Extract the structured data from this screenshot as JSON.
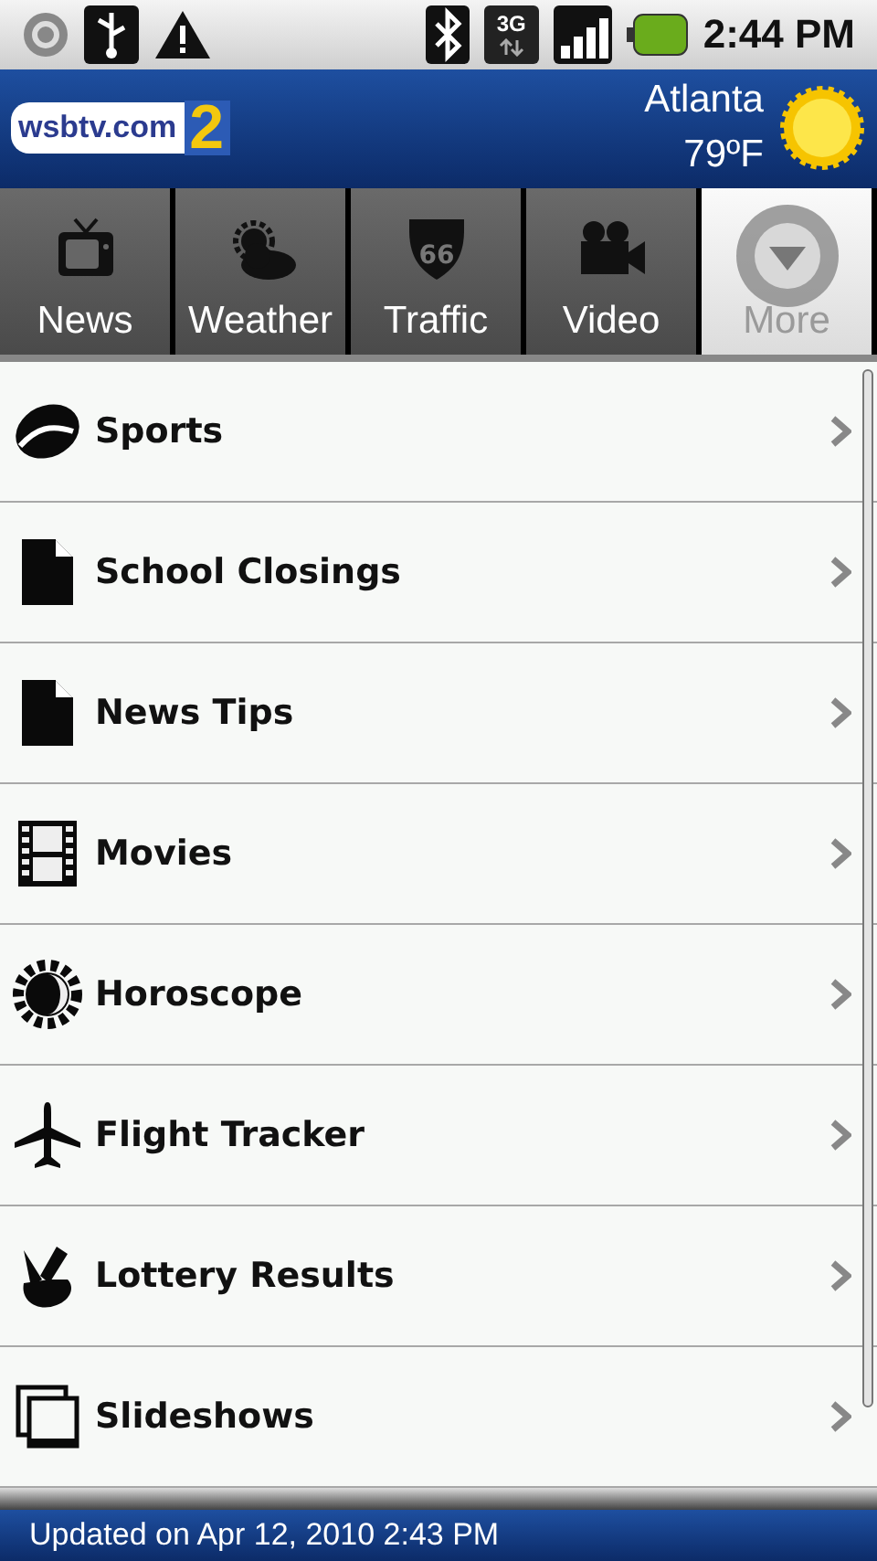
{
  "status_bar": {
    "network": "3G",
    "time": "2:44 PM"
  },
  "header": {
    "logo_text": "wsbtv.com",
    "logo_number": "2",
    "city": "Atlanta",
    "temperature": "79ºF"
  },
  "tabs": [
    {
      "label": "News",
      "kind": "news",
      "selected": false
    },
    {
      "label": "Weather",
      "kind": "weather",
      "selected": false
    },
    {
      "label": "Traffic",
      "kind": "traffic",
      "sign": "66",
      "selected": false
    },
    {
      "label": "Video",
      "kind": "video",
      "selected": false
    },
    {
      "label": "More",
      "kind": "more",
      "selected": true
    }
  ],
  "menu": [
    {
      "label": "Sports",
      "kind": "football"
    },
    {
      "label": "School Closings",
      "kind": "document"
    },
    {
      "label": "News Tips",
      "kind": "document"
    },
    {
      "label": "Movies",
      "kind": "film"
    },
    {
      "label": "Horoscope",
      "kind": "sun-moon"
    },
    {
      "label": "Flight Tracker",
      "kind": "plane"
    },
    {
      "label": "Lottery Results",
      "kind": "fingers"
    },
    {
      "label": "Slideshows",
      "kind": "slides"
    }
  ],
  "footer": {
    "updated": "Updated on Apr 12, 2010 2:43 PM"
  }
}
